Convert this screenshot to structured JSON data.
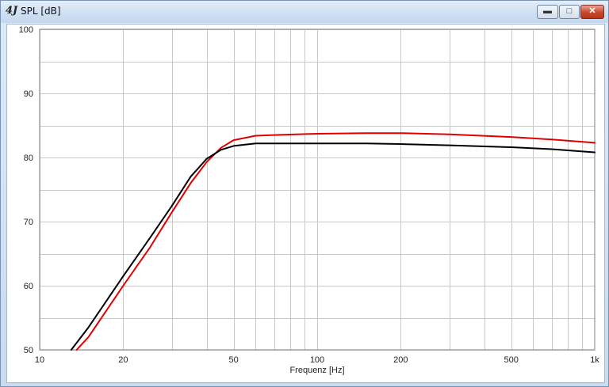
{
  "window": {
    "title": "SPL [dB]",
    "app_icon": "app-logo-icon",
    "buttons": {
      "minimize": "minimize-icon",
      "maximize": "maximize-icon",
      "close": "close-icon"
    }
  },
  "chart_data": {
    "type": "line",
    "title": "",
    "xlabel": "Frequenz [Hz]",
    "ylabel": "",
    "xscale": "log",
    "xlim": [
      10,
      1000
    ],
    "ylim": [
      50,
      100
    ],
    "grid": true,
    "x_ticks": [
      10,
      20,
      50,
      100,
      200,
      500,
      1000
    ],
    "x_tick_labels": [
      "10",
      "20",
      "50",
      "100",
      "200",
      "500",
      "1k"
    ],
    "y_ticks": [
      50,
      60,
      70,
      80,
      90,
      100
    ],
    "y_tick_labels": [
      "50",
      "60",
      "70",
      "80",
      "90",
      "100"
    ],
    "series": [
      {
        "color": "#e00000",
        "x": [
          13.6,
          15,
          20,
          25,
          30,
          35,
          40,
          45,
          50,
          60,
          70,
          100,
          150,
          200,
          300,
          500,
          700,
          1000
        ],
        "y": [
          50,
          52,
          60,
          66,
          71.5,
          76,
          79.3,
          81.5,
          82.7,
          83.4,
          83.5,
          83.7,
          83.8,
          83.8,
          83.6,
          83.2,
          82.8,
          82.3
        ]
      },
      {
        "color": "#000000",
        "x": [
          13,
          15,
          20,
          25,
          30,
          35,
          40,
          45,
          50,
          60,
          70,
          100,
          150,
          200,
          300,
          500,
          700,
          1000
        ],
        "y": [
          50,
          53.5,
          61.5,
          67.5,
          72.5,
          77,
          79.8,
          81.2,
          81.8,
          82.2,
          82.2,
          82.2,
          82.2,
          82.1,
          81.9,
          81.6,
          81.3,
          80.8
        ]
      }
    ]
  }
}
